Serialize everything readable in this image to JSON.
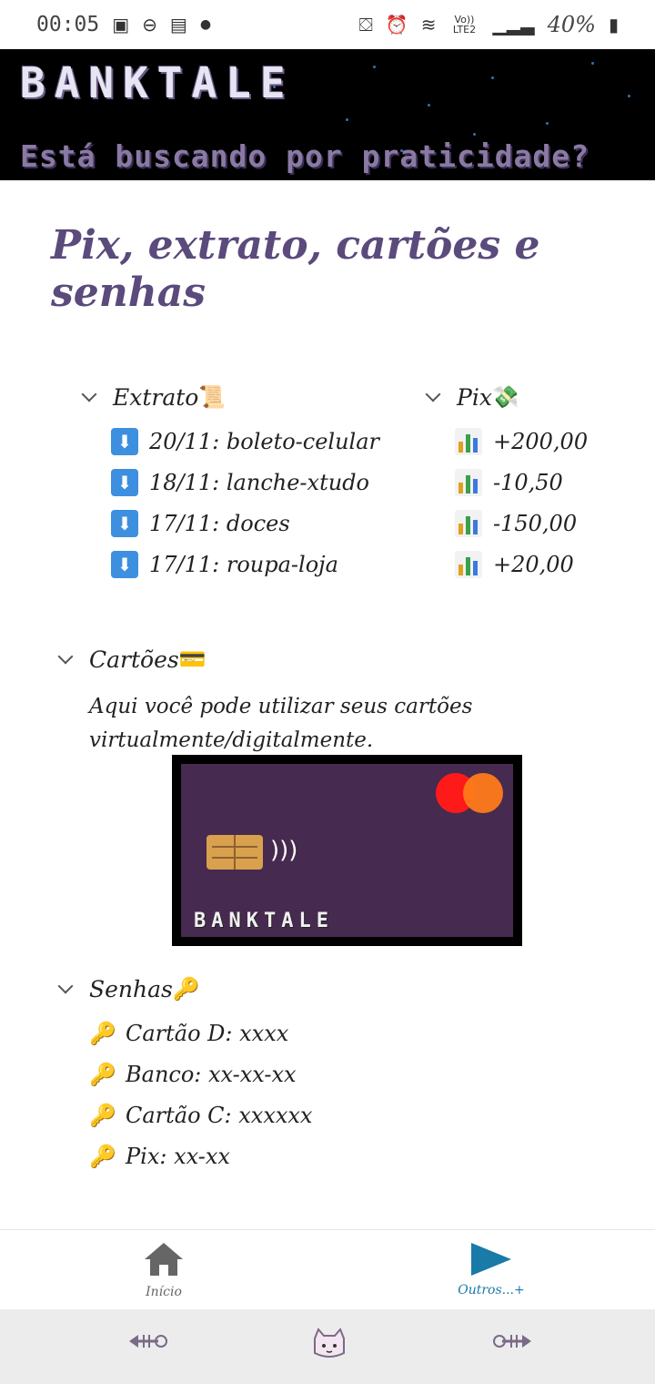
{
  "status_bar": {
    "time": "00:05",
    "battery_percent": "40%",
    "network": "Vo)) LTE2",
    "icons": [
      "image-icon",
      "dnd-icon",
      "cast-icon",
      "dot-icon",
      "sim-icon",
      "alarm-icon",
      "wifi-icon",
      "signal-icon",
      "battery-icon"
    ]
  },
  "banner": {
    "brand": "BANKTALE",
    "tagline": "Está buscando por praticidade?"
  },
  "page": {
    "title": "Pix, extrato, cartões e senhas"
  },
  "extrato": {
    "heading": "Extrato",
    "emoji": "📜",
    "items": [
      "20/11: boleto-celular",
      "18/11: lanche-xtudo",
      "17/11: doces",
      "17/11: roupa-loja"
    ]
  },
  "pix": {
    "heading": "Pix",
    "emoji": "💸",
    "items": [
      "+200,00",
      "-10,50",
      "-150,00",
      "+20,00"
    ]
  },
  "cartoes": {
    "heading": "Cartões",
    "emoji": "💳",
    "description": "Aqui você pode utilizar seus cartões virtualmente/digitalmente.",
    "card_brand": "BANKTALE"
  },
  "senhas": {
    "heading": "Senhas",
    "emoji": "🔑",
    "items": [
      "Cartão D: xxxx",
      "Banco: xx-xx-xx",
      "Cartão C: xxxxxx",
      "Pix: xx-xx"
    ]
  },
  "nav": {
    "home_label": "Início",
    "others_label": "Outros...+",
    "active_color": "#1a7aa8",
    "inactive_color": "#666666"
  },
  "colors": {
    "title": "#5b4a7c",
    "card_bg": "#472a4f",
    "banner_bg": "#000000"
  }
}
